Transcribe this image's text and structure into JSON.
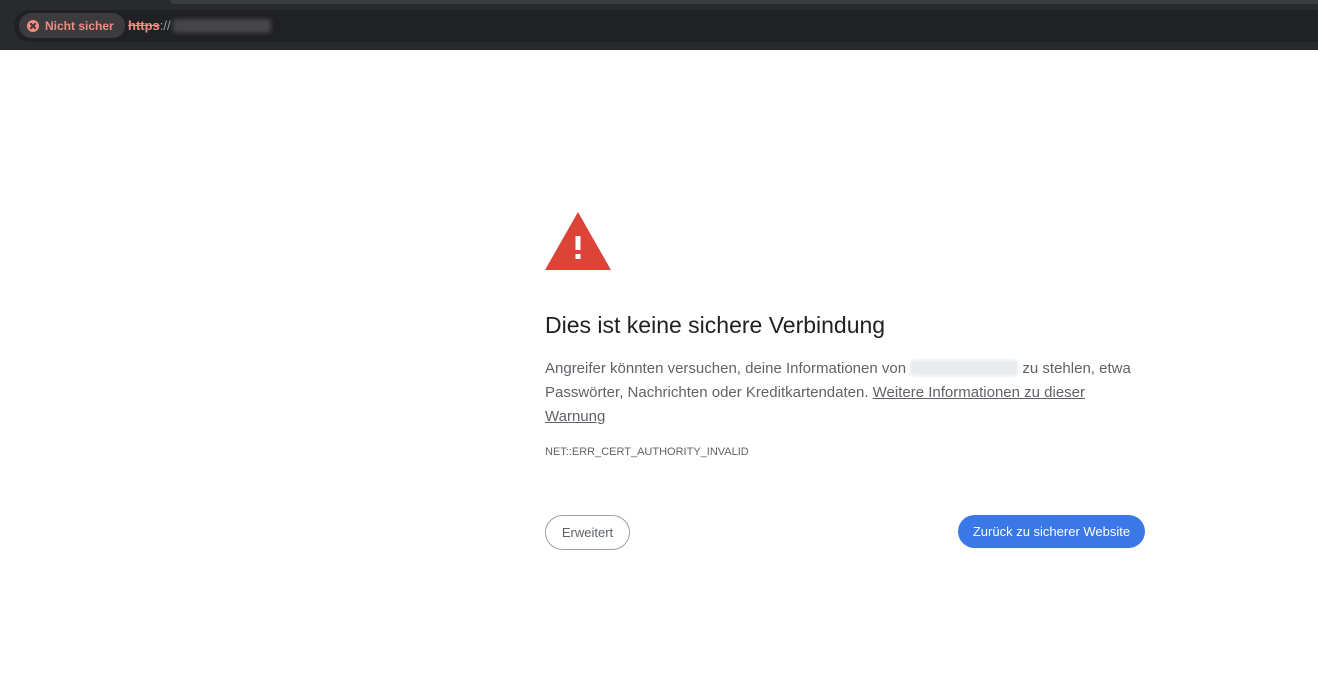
{
  "browser": {
    "security_chip": {
      "label": "Nicht sicher",
      "icon": "error-circle-icon",
      "color": "#f28b82"
    },
    "url": {
      "scheme": "https",
      "separator": "://"
    }
  },
  "interstitial": {
    "icon": "warning-triangle-icon",
    "icon_color": "#db4437",
    "heading": "Dies ist keine sichere Verbindung",
    "explanation_before": "Angreifer könnten versuchen, deine Informationen von ",
    "explanation_after": " zu stehlen, etwa Passwörter, Nachrichten oder Kreditkartendaten. ",
    "learn_more_link": "Weitere Informationen zu dieser Warnung",
    "error_code": "NET::ERR_CERT_AUTHORITY_INVALID",
    "advanced_button": "Erweitert",
    "back_button": "Zurück zu sicherer Website",
    "accent_color": "#3b78e7"
  }
}
